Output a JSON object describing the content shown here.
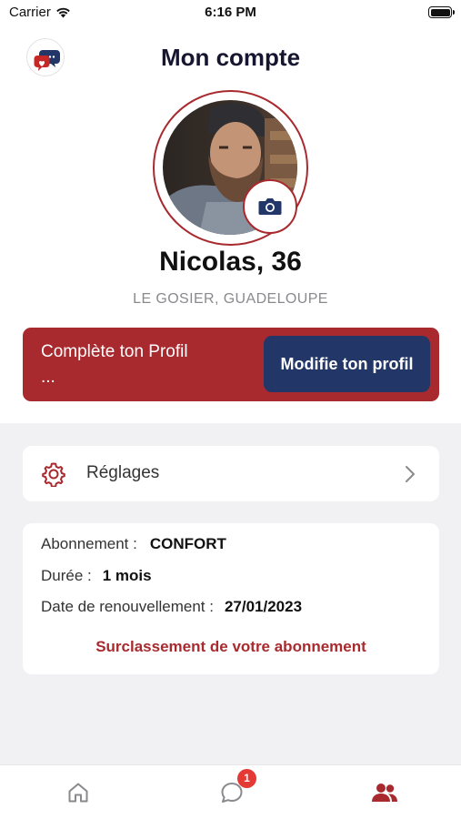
{
  "status_bar": {
    "carrier": "Carrier",
    "time": "6:16 PM"
  },
  "header": {
    "title": "Mon compte"
  },
  "profile": {
    "name": "Nicolas, 36",
    "location": "LE GOSIER, GUADELOUPE"
  },
  "banner": {
    "text": "Complète ton Profil ...",
    "button_label": "Modifie ton profil"
  },
  "settings": {
    "label": "Réglages"
  },
  "subscription": {
    "plan_label": "Abonnement :",
    "plan_value": "CONFORT",
    "duration_label": "Durée :",
    "duration_value": "1 mois",
    "renewal_label": "Date de renouvellement :",
    "renewal_value": "27/01/2023",
    "upgrade_link": "Surclassement de votre abonnement"
  },
  "tab_bar": {
    "tabs": [
      {
        "name": "home",
        "icon": "home-icon",
        "active": false
      },
      {
        "name": "messages",
        "icon": "chat-bubble-icon",
        "active": false
      },
      {
        "name": "account",
        "icon": "users-icon",
        "active": true
      }
    ],
    "messages_badge": "1"
  },
  "colors": {
    "accent_red": "#a82a2e",
    "navy": "#223667",
    "badge_red": "#e53935",
    "background_gray": "#f1f1f3"
  }
}
